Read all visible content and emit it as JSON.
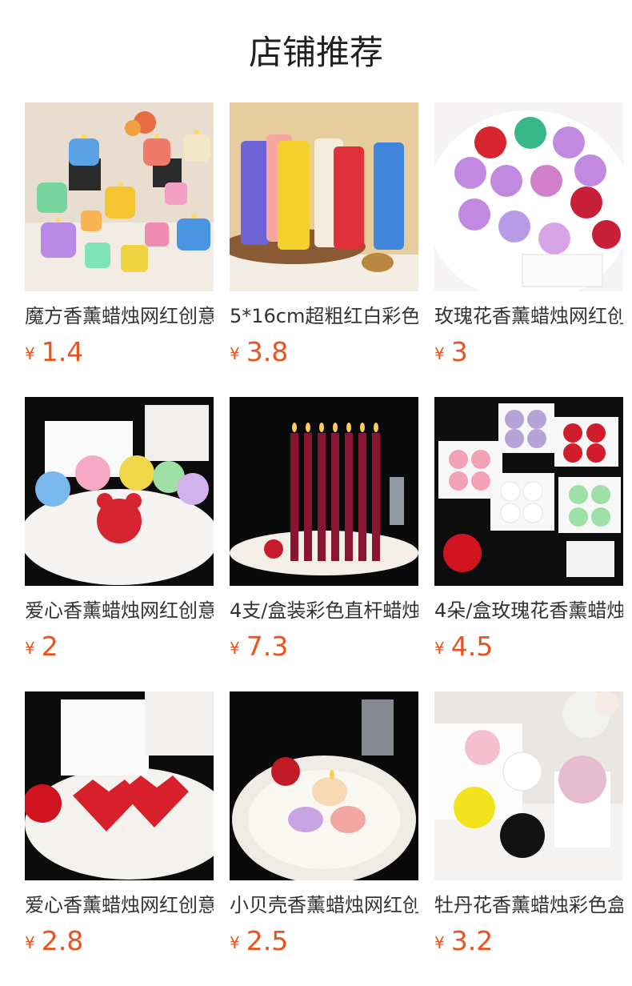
{
  "header": {
    "title": "店铺推荐"
  },
  "currency_symbol": "¥",
  "products": [
    {
      "name": "魔方香薰蜡烛网红创意",
      "price": "1.4",
      "image": "cube-candles"
    },
    {
      "name": "5*16cm超粗红白彩色",
      "price": "3.8",
      "image": "pillar-candles"
    },
    {
      "name": "玫瑰花香薰蜡烛网红创意",
      "price": "3",
      "image": "rose-candles"
    },
    {
      "name": "爱心香薰蜡烛网红创意",
      "price": "2",
      "image": "bear-candles"
    },
    {
      "name": "4支/盒装彩色直杆蜡烛",
      "price": "7.3",
      "image": "taper-candles"
    },
    {
      "name": "4朵/盒玫瑰花香薰蜡烛",
      "price": "4.5",
      "image": "rose-box-candles"
    },
    {
      "name": "爱心香薰蜡烛网红创意",
      "price": "2.8",
      "image": "heart-candles"
    },
    {
      "name": "小贝壳香薰蜡烛网红创意",
      "price": "2.5",
      "image": "shell-candles"
    },
    {
      "name": "牡丹花香薰蜡烛彩色盒装",
      "price": "3.2",
      "image": "peony-candles"
    }
  ]
}
